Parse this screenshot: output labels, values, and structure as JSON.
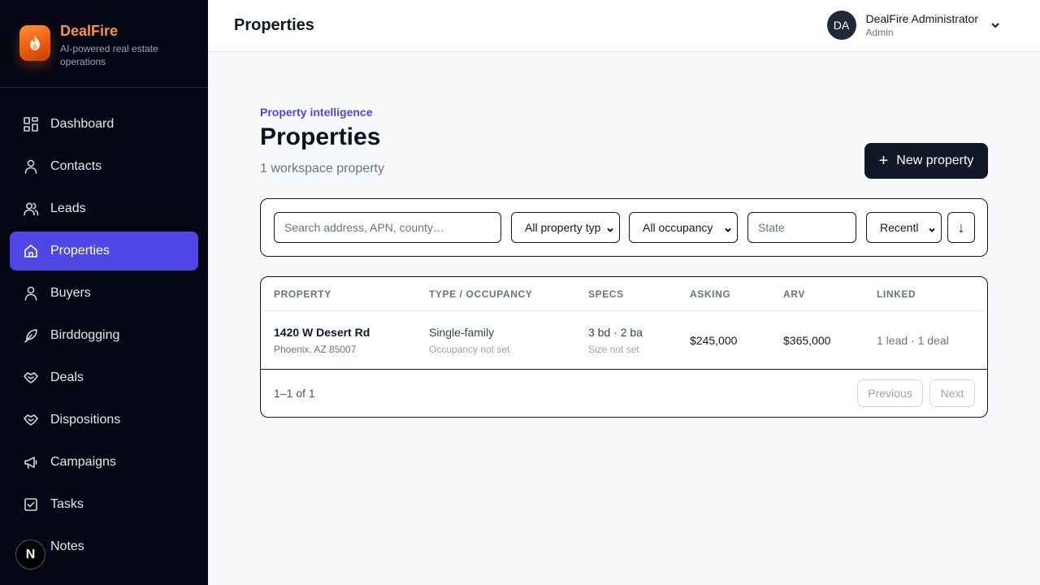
{
  "brand": {
    "name": "DealFire",
    "tagline": "AI-powered real estate operations"
  },
  "nav": [
    {
      "label": "Dashboard",
      "icon": "dashboard-icon"
    },
    {
      "label": "Contacts",
      "icon": "user-icon"
    },
    {
      "label": "Leads",
      "icon": "users-icon"
    },
    {
      "label": "Properties",
      "icon": "home-icon",
      "active": true
    },
    {
      "label": "Buyers",
      "icon": "user-icon"
    },
    {
      "label": "Birddogging",
      "icon": "feather-icon"
    },
    {
      "label": "Deals",
      "icon": "handshake-icon"
    },
    {
      "label": "Dispositions",
      "icon": "handshake-icon"
    },
    {
      "label": "Campaigns",
      "icon": "megaphone-icon"
    },
    {
      "label": "Tasks",
      "icon": "checkbox-icon"
    },
    {
      "label": "Notes",
      "icon": "note-icon"
    }
  ],
  "floating_badge": "N",
  "topbar": {
    "title": "Properties"
  },
  "user": {
    "initials": "DA",
    "name": "DealFire Administrator",
    "role": "Admin"
  },
  "header": {
    "eyebrow": "Property intelligence",
    "title": "Properties",
    "subtitle": "1 workspace property",
    "new_button": "New property"
  },
  "filters": {
    "search_placeholder": "Search address, APN, county…",
    "property_type": "All property typ",
    "occupancy": "All occupancy",
    "state_placeholder": "State",
    "sort": "Recentl",
    "sort_direction": "↓"
  },
  "table": {
    "columns": [
      "PROPERTY",
      "TYPE / OCCUPANCY",
      "SPECS",
      "ASKING",
      "ARV",
      "LINKED"
    ],
    "rows": [
      {
        "address": "1420 W Desert Rd",
        "city": "Phoenix, AZ 85007",
        "type": "Single-family",
        "occupancy": "Occupancy not set",
        "specs": "3 bd · 2 ba",
        "size": "Size not set",
        "asking": "$245,000",
        "arv": "$365,000",
        "linked": "1 lead · 1 deal"
      }
    ],
    "count": "1–1 of 1",
    "prev": "Previous",
    "next": "Next"
  },
  "colors": {
    "accent": "#4f46e5",
    "brand": "#fb923c",
    "sidebar": "#050814"
  }
}
